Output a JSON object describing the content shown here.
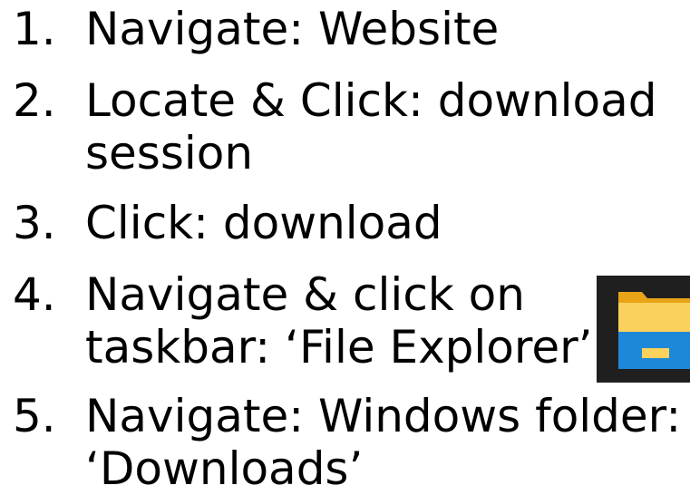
{
  "steps": [
    {
      "number": "1.",
      "lines": [
        "Navigate: Website"
      ]
    },
    {
      "number": "2.",
      "lines": [
        "Locate & Click: download",
        "session"
      ]
    },
    {
      "number": "3.",
      "lines": [
        "Click: download"
      ]
    },
    {
      "number": "4.",
      "lines": [
        "Navigate & click on",
        "taskbar: ‘File Explorer’"
      ]
    },
    {
      "number": "5.",
      "lines": [
        "Navigate: Windows folder:",
        "‘Downloads’"
      ]
    }
  ],
  "icon": {
    "name": "file-explorer-icon",
    "background": "#1f1f1f",
    "folder_back": "#e8a317",
    "folder_front": "#f9d15c",
    "drawer": "#1e88d8"
  }
}
